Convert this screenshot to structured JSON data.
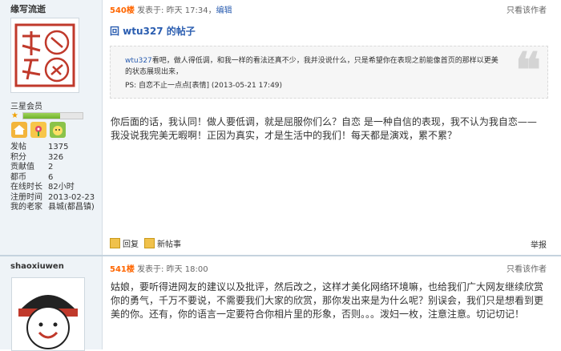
{
  "colors": {
    "accent": "#2a5db0",
    "floor": "#ff6600",
    "sidebar_bg": "#eef3f7",
    "level_bar": "#7fbf3a"
  },
  "post1": {
    "author": {
      "name": "缘写流逝",
      "rank": "三星会员",
      "level_progress": 0.62,
      "stats": [
        {
          "label": "发帖",
          "value": "1375"
        },
        {
          "label": "积分",
          "value": "326"
        },
        {
          "label": "贡献值",
          "value": "2"
        },
        {
          "label": "都币",
          "value": "6"
        },
        {
          "label": "在线时长",
          "value": "82小时"
        },
        {
          "label": "注册时间",
          "value": "2013-02-23"
        },
        {
          "label": "我的老家",
          "value": "县城(都昌镇)"
        }
      ],
      "badges": [
        "home-icon",
        "flower-icon",
        "pet-icon"
      ]
    },
    "header": {
      "floor": "540楼",
      "posted": "发表于: 昨天 17:34",
      "sep": "，",
      "edit": "编辑",
      "only_author": "只看该作者"
    },
    "reply_title": "回 wtu327 的帖子",
    "quote": {
      "name": "wtu327",
      "text": "看吧，做人得低调，和我一样的看法还真不少，我并没说什么，只是希望你在表现之前能像首页的那样以更美的状态展现出来，",
      "sig": "PS: 自恋不止一点点[表情] (2013-05-21 17:49)",
      "mark": "❝"
    },
    "body": "你后面的话，我认同！做人要低调，就是屈服你们么？自恋 是一种自信的表现，我不认为我自恋——我没说我完美无暇啊！正因为真实，才是生活中的我们！每天都是演戏，累不累？",
    "actions": {
      "reply": "回复",
      "new_post": "新帖事",
      "report": "举报"
    }
  },
  "post2": {
    "author": {
      "name": "shaoxiuwen"
    },
    "header": {
      "floor": "541楼",
      "posted": "发表于: 昨天 18:00",
      "only_author": "只看该作者"
    },
    "body": "姑娘，要听得进网友的建议以及批评，然后改之，这样才美化网络环境嘛，也给我们广大网友继续欣赏你的勇气，千万不要说，不需要我们大家的欣赏，那你发出来是为什么呢？别误会，我们只是想看到更美的你。还有，你的语言一定要符合你相片里的形象，否则。。。泼妇一枚，注意注意。切记切记！"
  }
}
